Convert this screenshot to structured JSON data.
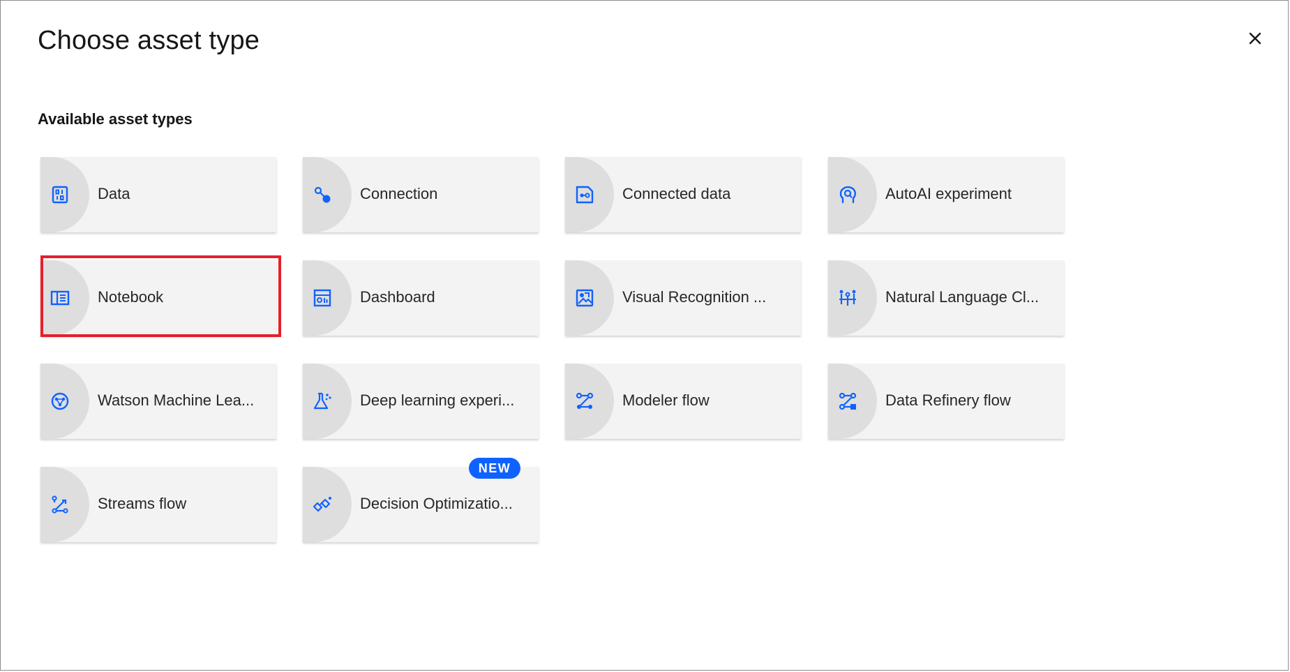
{
  "dialog": {
    "title": "Choose asset type",
    "close_icon": "close-icon"
  },
  "section": {
    "label": "Available asset types"
  },
  "colors": {
    "icon_blue": "#0f62fe",
    "tile_bg": "#f3f3f3",
    "tile_accent": "#dedede",
    "badge_bg": "#0f62fe",
    "highlight": "#e5202a"
  },
  "tiles": [
    {
      "label": "Data",
      "icon": "data-icon"
    },
    {
      "label": "Connection",
      "icon": "connection-icon"
    },
    {
      "label": "Connected data",
      "icon": "connected-data-icon"
    },
    {
      "label": "AutoAI experiment",
      "icon": "autoai-icon"
    },
    {
      "label": "Notebook",
      "icon": "notebook-icon",
      "highlighted": true
    },
    {
      "label": "Dashboard",
      "icon": "dashboard-icon"
    },
    {
      "label": "Visual Recognition ...",
      "icon": "visual-recognition-icon"
    },
    {
      "label": "Natural Language Cl...",
      "icon": "natural-language-icon"
    },
    {
      "label": "Watson Machine Lea...",
      "icon": "machine-learning-icon"
    },
    {
      "label": "Deep learning experi...",
      "icon": "deep-learning-icon"
    },
    {
      "label": "Modeler flow",
      "icon": "modeler-flow-icon"
    },
    {
      "label": "Data Refinery flow",
      "icon": "data-refinery-icon"
    },
    {
      "label": "Streams flow",
      "icon": "streams-flow-icon"
    },
    {
      "label": "Decision Optimizatio...",
      "icon": "decision-optimization-icon",
      "badge": "NEW"
    }
  ]
}
